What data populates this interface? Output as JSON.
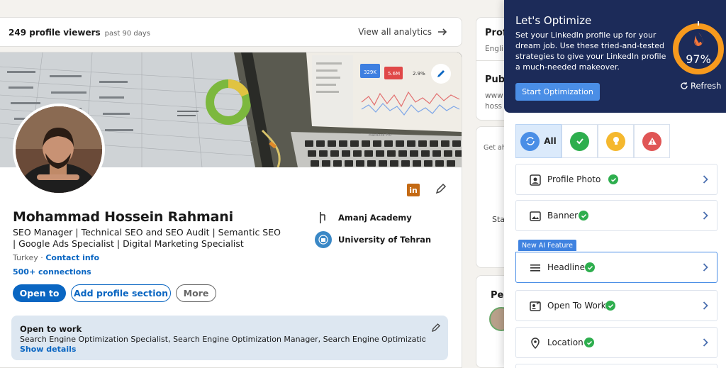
{
  "analytics": {
    "viewers": "249 profile viewers",
    "period": "past 90 days",
    "view_all": "View all analytics"
  },
  "profile": {
    "name": "Mohammad Hossein Rahmani",
    "headline": "SEO Manager | Technical SEO and SEO Audit | Semantic SEO | Google Ads Specialist | Digital Marketing Specialist",
    "location": "Turkey",
    "location_sep": " · ",
    "contact_info": "Contact info",
    "connections": "500+ connections",
    "buttons": {
      "open_to": "Open to",
      "add_section": "Add profile section",
      "more": "More"
    },
    "experience": [
      {
        "name": "Amanj Academy"
      },
      {
        "name": "University of Tehran"
      }
    ],
    "linkedin_icon_text": "in",
    "open_to_work": {
      "title": "Open to work",
      "description": "Search Engine Optimization Specialist, Search Engine Optimization Manager, Search Engine Optimization C...",
      "show_details": "Show details"
    },
    "banner_screen": {
      "kpi_1": "329K",
      "kpi_2": "5.6M",
      "kpi_3": "2.9%",
      "laptop_label": "MacBook Pro"
    }
  },
  "right_rail": {
    "card1_title": "Prof",
    "card1_sub": "Engli",
    "card1_title2": "Publ",
    "card1_line1": "www",
    "card1_line2": "hoss",
    "card2_text": "Get ah",
    "card2_text2": "Sta",
    "card3_title": "Peo"
  },
  "optimizer": {
    "title": "Let's Optimize",
    "description": "Set your LinkedIn profile up for your dream job. Use these tried-and-tested strategies to give your LinkedIn profile a much-needed makeover.",
    "start_button": "Start Optimization",
    "score": "97%",
    "score_fraction": 0.97,
    "refresh": "Refresh",
    "filters": {
      "all": "All"
    },
    "badge": "New AI Feature",
    "items": [
      {
        "label": "Profile Photo"
      },
      {
        "label": "Banner"
      },
      {
        "label": "Headline"
      },
      {
        "label": "Open To Work"
      },
      {
        "label": "Location"
      }
    ],
    "colors": {
      "header_bg": "#1c2b59",
      "accent": "#4a8ee6",
      "success": "#2eae4e",
      "warning": "#f5b82e",
      "danger": "#e05555",
      "score_ring": "#f79a1e"
    }
  },
  "colors": {
    "linkedin_blue": "#0a66c2"
  }
}
